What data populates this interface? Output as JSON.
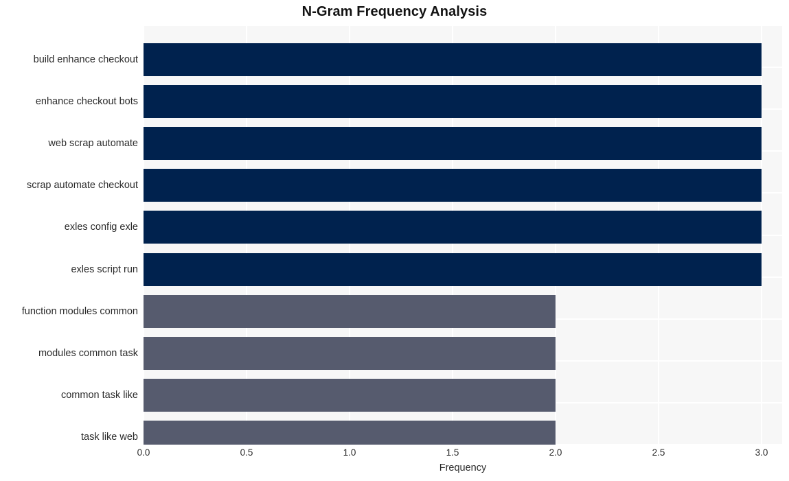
{
  "chart_data": {
    "type": "bar",
    "orientation": "horizontal",
    "title": "N-Gram Frequency Analysis",
    "xlabel": "Frequency",
    "ylabel": "",
    "xlim": [
      0.0,
      3.1
    ],
    "xticks": [
      "0.0",
      "0.5",
      "1.0",
      "1.5",
      "2.0",
      "2.5",
      "3.0"
    ],
    "xtick_values": [
      0.0,
      0.5,
      1.0,
      1.5,
      2.0,
      2.5,
      3.0
    ],
    "grid": true,
    "legend": "none",
    "categories": [
      "build enhance checkout",
      "enhance checkout bots",
      "web scrap automate",
      "scrap automate checkout",
      "exles config exle",
      "exles script run",
      "function modules common",
      "modules common task",
      "common task like",
      "task like web"
    ],
    "values": [
      3,
      3,
      3,
      3,
      3,
      3,
      2,
      2,
      2,
      2
    ],
    "bar_colors": [
      "#00224e",
      "#00224e",
      "#00224e",
      "#00224e",
      "#00224e",
      "#00224e",
      "#565b6e",
      "#565b6e",
      "#565b6e",
      "#565b6e"
    ]
  },
  "style": {
    "plot_background": "#f7f7f7",
    "gridline_color": "#ffffff",
    "figure_background": "#ffffff",
    "text_color": "#2b2b2b",
    "title_color": "#111111"
  }
}
